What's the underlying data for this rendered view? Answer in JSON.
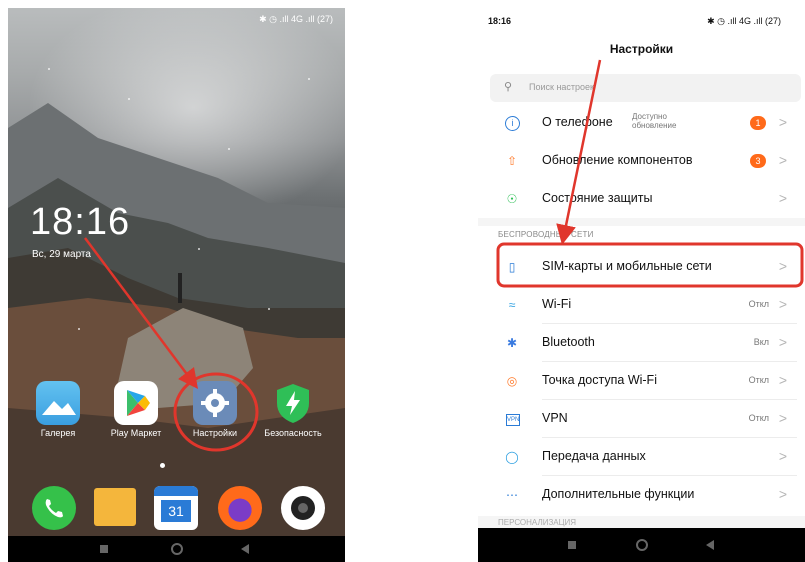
{
  "left": {
    "status_text": "✱ ◷ .ıll 4G .ıll (27)",
    "clock": "18:16",
    "date": "Вс, 29 марта",
    "apps": [
      {
        "label": "Галерея",
        "icon": "gallery-icon"
      },
      {
        "label": "Play Маркет",
        "icon": "play-store-icon"
      },
      {
        "label": "Настройки",
        "icon": "settings-gear-icon"
      },
      {
        "label": "Безопасность",
        "icon": "security-shield-icon"
      }
    ],
    "dock": [
      {
        "icon": "phone-icon",
        "color": "#35c14a"
      },
      {
        "icon": "messages-icon",
        "color": "#f4b63c"
      },
      {
        "icon": "calendar-icon",
        "color": "#2a7bd6",
        "text": "31"
      },
      {
        "icon": "firefox-icon",
        "color": "#ff6a1a"
      },
      {
        "icon": "camera-icon",
        "color": "#ffffff"
      }
    ]
  },
  "right": {
    "time": "18:16",
    "status_text": "✱ ◷ .ıll 4G .ıll (27)",
    "title": "Настройки",
    "search_placeholder": "Поиск настроек",
    "rows_top": [
      {
        "label": "О телефоне",
        "sub": "Доступно обновление",
        "badge": "1",
        "icon": "info-icon"
      },
      {
        "label": "Обновление компонентов",
        "badge": "3",
        "icon": "update-icon"
      },
      {
        "label": "Состояние защиты",
        "icon": "shield-check-icon"
      }
    ],
    "section_label": "БЕСПРОВОДНЫЕ СЕТИ",
    "rows_wireless": [
      {
        "label": "SIM-карты и мобильные сети",
        "value": "",
        "icon": "sim-card-icon"
      },
      {
        "label": "Wi-Fi",
        "value": "Откл",
        "icon": "wifi-icon"
      },
      {
        "label": "Bluetooth",
        "value": "Вкл",
        "icon": "bluetooth-icon"
      },
      {
        "label": "Точка доступа Wi-Fi",
        "value": "Откл",
        "icon": "hotspot-icon"
      },
      {
        "label": "VPN",
        "value": "Откл",
        "icon": "vpn-icon"
      },
      {
        "label": "Передача данных",
        "value": "",
        "icon": "data-usage-icon"
      },
      {
        "label": "Дополнительные функции",
        "value": "",
        "icon": "more-icon"
      }
    ],
    "bottom_section_partial": "ПЕРСОНАЛИЗАЦИЯ"
  },
  "colors": {
    "annotation": "#e0362c",
    "badge": "#ff6a1a",
    "settings_icon": "#6b8bb8"
  }
}
